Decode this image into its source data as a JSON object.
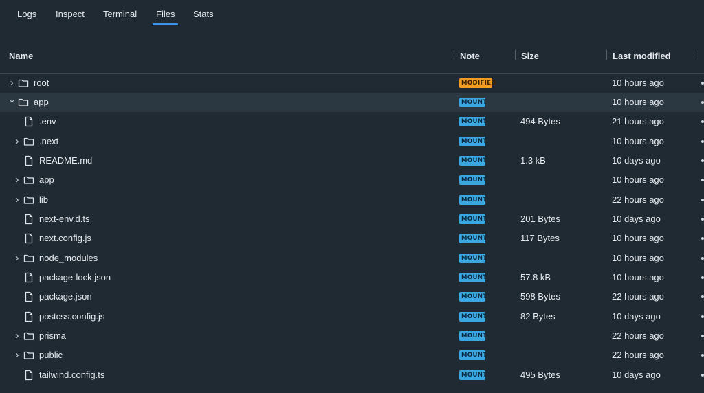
{
  "tabs": [
    {
      "label": "Logs"
    },
    {
      "label": "Inspect"
    },
    {
      "label": "Terminal"
    },
    {
      "label": "Files",
      "active": true
    },
    {
      "label": "Stats"
    }
  ],
  "table": {
    "columns": {
      "name": "Name",
      "note": "Note",
      "size": "Size",
      "modified": "Last modified"
    },
    "rows": [
      {
        "name": "root",
        "type": "folder",
        "expanded": false,
        "depth": 0,
        "note": "MODIFIED",
        "size": "",
        "modified": "10 hours ago"
      },
      {
        "name": "app",
        "type": "folder",
        "expanded": true,
        "depth": 0,
        "selected": true,
        "note": "MOUNT",
        "size": "",
        "modified": "10 hours ago"
      },
      {
        "name": ".env",
        "type": "file",
        "depth": 1,
        "note": "MOUNT",
        "size": "494 Bytes",
        "modified": "21 hours ago"
      },
      {
        "name": ".next",
        "type": "folder",
        "expanded": false,
        "depth": 1,
        "note": "MOUNT",
        "size": "",
        "modified": "10 hours ago"
      },
      {
        "name": "README.md",
        "type": "file",
        "depth": 1,
        "note": "MOUNT",
        "size": "1.3 kB",
        "modified": "10 days ago"
      },
      {
        "name": "app",
        "type": "folder",
        "expanded": false,
        "depth": 1,
        "note": "MOUNT",
        "size": "",
        "modified": "10 hours ago"
      },
      {
        "name": "lib",
        "type": "folder",
        "expanded": false,
        "depth": 1,
        "note": "MOUNT",
        "size": "",
        "modified": "22 hours ago"
      },
      {
        "name": "next-env.d.ts",
        "type": "file",
        "depth": 1,
        "note": "MOUNT",
        "size": "201 Bytes",
        "modified": "10 days ago"
      },
      {
        "name": "next.config.js",
        "type": "file",
        "depth": 1,
        "note": "MOUNT",
        "size": "117 Bytes",
        "modified": "10 hours ago"
      },
      {
        "name": "node_modules",
        "type": "folder",
        "expanded": false,
        "depth": 1,
        "note": "MOUNT",
        "size": "",
        "modified": "10 hours ago"
      },
      {
        "name": "package-lock.json",
        "type": "file",
        "depth": 1,
        "note": "MOUNT",
        "size": "57.8 kB",
        "modified": "10 hours ago"
      },
      {
        "name": "package.json",
        "type": "file",
        "depth": 1,
        "note": "MOUNT",
        "size": "598 Bytes",
        "modified": "22 hours ago"
      },
      {
        "name": "postcss.config.js",
        "type": "file",
        "depth": 1,
        "note": "MOUNT",
        "size": "82 Bytes",
        "modified": "10 days ago"
      },
      {
        "name": "prisma",
        "type": "folder",
        "expanded": false,
        "depth": 1,
        "note": "MOUNT",
        "size": "",
        "modified": "22 hours ago"
      },
      {
        "name": "public",
        "type": "folder",
        "expanded": false,
        "depth": 1,
        "note": "MOUNT",
        "size": "",
        "modified": "22 hours ago"
      },
      {
        "name": "tailwind.config.ts",
        "type": "file",
        "depth": 1,
        "note": "MOUNT",
        "size": "495 Bytes",
        "modified": "10 days ago"
      }
    ]
  },
  "colors": {
    "background": "#1f2a33",
    "selected_row": "#2b3741",
    "accent": "#3b95f0",
    "mount_badge": "#3aa7e0",
    "modified_badge": "#f39c24"
  }
}
